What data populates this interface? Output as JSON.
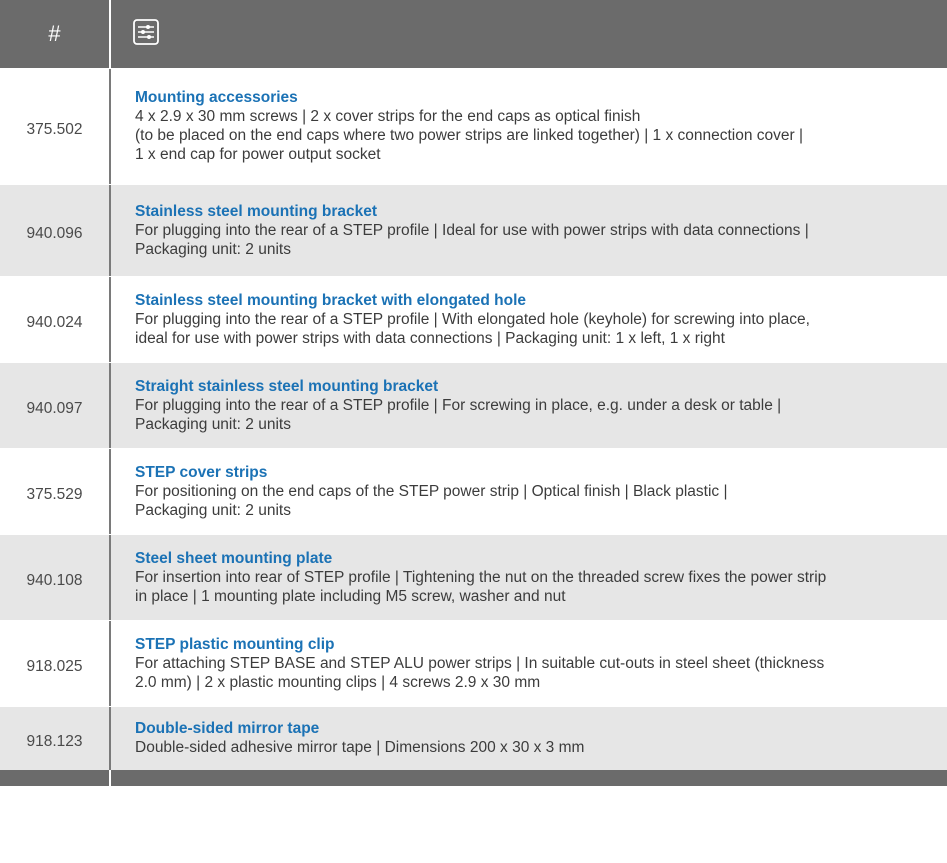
{
  "header": {
    "num_label": "#",
    "icon": "sliders-icon"
  },
  "rows": [
    {
      "num": "375.502",
      "title": "Mounting accessories",
      "desc": "4 x 2.9 x 30 mm screws | 2 x cover strips for the end caps as optical finish\n(to be placed on the end caps where two power strips are linked together) | 1 x connection cover |\n1 x end cap for power output socket"
    },
    {
      "num": "940.096",
      "title": "Stainless steel mounting bracket",
      "desc": "For plugging into the rear of a STEP profile | Ideal for use with power strips with data connections |\nPackaging unit: 2 units"
    },
    {
      "num": "940.024",
      "title": "Stainless steel mounting bracket with elongated hole",
      "desc": "For plugging into the rear of a STEP profile | With elongated hole (keyhole) for screwing into place,\nideal for use with power strips with data connections | Packaging unit: 1 x left, 1 x right"
    },
    {
      "num": "940.097",
      "title": "Straight stainless steel mounting bracket",
      "desc": "For plugging into the rear of a STEP profile | For screwing in place, e.g. under a desk or table |\nPackaging unit: 2 units"
    },
    {
      "num": "375.529",
      "title": "STEP cover strips",
      "desc": "For positioning on the end caps of the STEP power strip | Optical finish | Black plastic |\nPackaging unit: 2 units"
    },
    {
      "num": "940.108",
      "title": "Steel sheet mounting plate",
      "desc": "For insertion into rear of STEP profile | Tightening the nut on the threaded screw fixes the power strip\nin place | 1 mounting plate including M5 screw, washer and nut"
    },
    {
      "num": "918.025",
      "title": "STEP plastic mounting clip",
      "desc": "For attaching STEP BASE and STEP ALU power strips | In suitable cut-outs in steel sheet (thickness\n2.0 mm) | 2 x plastic mounting clips | 4 screws 2.9 x 30 mm"
    },
    {
      "num": "918.123",
      "title": "Double-sided mirror tape",
      "desc": "Double-sided adhesive mirror tape | Dimensions 200 x 30 x 3 mm"
    }
  ],
  "colors": {
    "header_bg": "#6b6b6b",
    "title_blue": "#1b72b5",
    "row_grey": "#e6e6e6"
  }
}
